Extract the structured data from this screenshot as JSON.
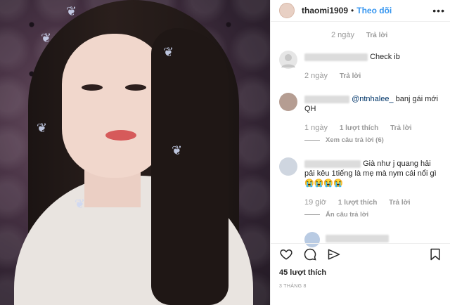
{
  "header": {
    "username": "thaomi1909",
    "separator": "•",
    "follow_label": "Theo dõi",
    "more_label": "•••"
  },
  "top_meta": {
    "time": "2 ngày",
    "reply": "Trả lời"
  },
  "comments": [
    {
      "text": "Check ib",
      "time": "2 ngày",
      "reply": "Trả lời"
    },
    {
      "mention": "@ntnhalee_",
      "text": " banj gái mới QH",
      "time": "1 ngày",
      "likes": "1 lượt thích",
      "reply": "Trả lời",
      "view_replies": "Xem câu trả lời (6)"
    },
    {
      "text": "Già như j quang hải pải kêu 1tiếng là mẹ mà nym cái nổi gì 😭😭😭😭",
      "time": "19 giờ",
      "likes": "1 lượt thích",
      "reply": "Trả lời",
      "hide_replies": "Ẩn câu trả lời"
    }
  ],
  "footer": {
    "likes": "45 lượt thích",
    "date": "3 THÁNG 8"
  },
  "icons": [
    "heart-icon",
    "comment-icon",
    "share-icon",
    "bookmark-icon"
  ],
  "colors": {
    "link": "#3897f0",
    "muted": "#999999",
    "text": "#262626"
  }
}
